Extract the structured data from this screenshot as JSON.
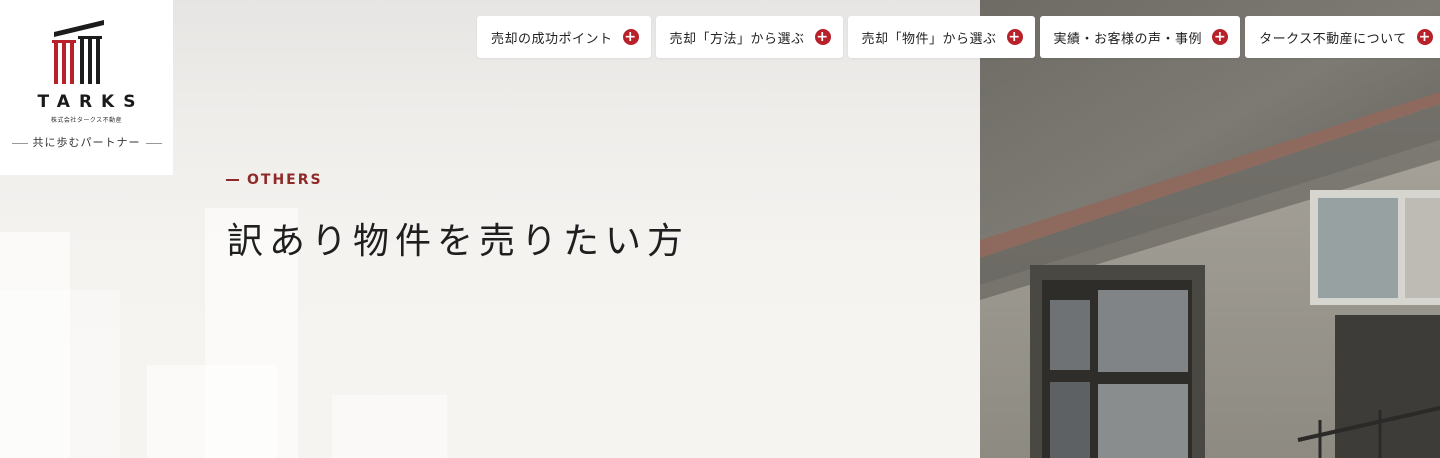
{
  "brand": {
    "logo_text": "TARKS",
    "company_name": "株式会社タークス不動産",
    "tagline": "共に歩むパートナー",
    "accent": "#b8212a"
  },
  "nav": {
    "items": [
      {
        "label": "売却の成功ポイント",
        "icon": "plus-icon"
      },
      {
        "label": "売却「方法」から選ぶ",
        "icon": "plus-icon"
      },
      {
        "label": "売却「物件」から選ぶ",
        "icon": "plus-icon"
      },
      {
        "label": "実績・お客様の声・事例",
        "icon": "plus-icon"
      },
      {
        "label": "タークス不動産について",
        "icon": "plus-icon"
      }
    ]
  },
  "hero": {
    "eyebrow": "OTHERS",
    "title": "訳あり物件を売りたい方",
    "eyebrow_color": "#8e2a2a"
  }
}
